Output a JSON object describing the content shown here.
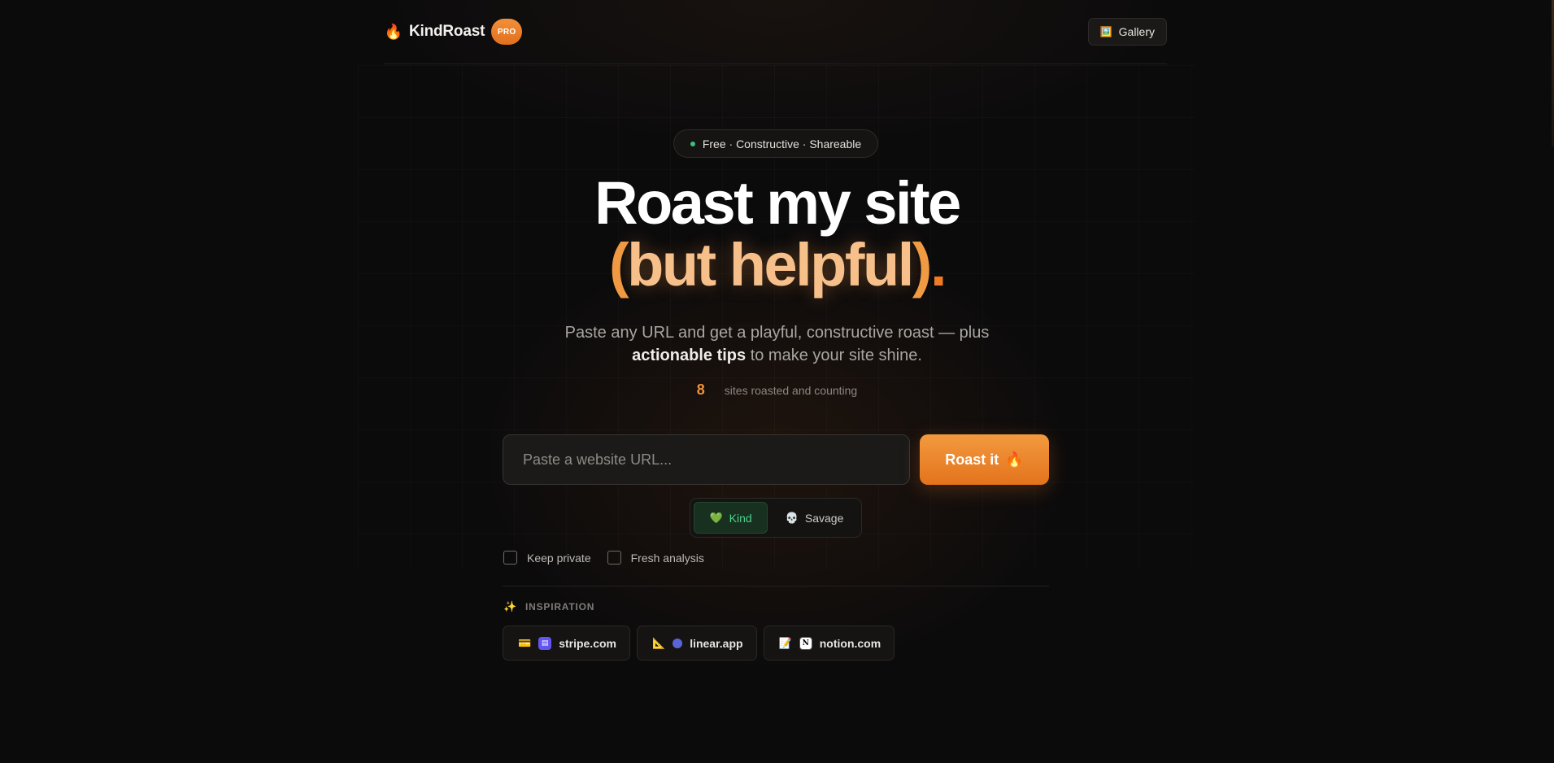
{
  "header": {
    "brand_icon": "fire-icon",
    "brand_name": "KindRoast",
    "pro_badge": "PRO",
    "gallery_icon": "picture-icon",
    "gallery_label": "Gallery"
  },
  "hero": {
    "pill_text": "Free · Constructive · Shareable",
    "title_line1": "Roast my site",
    "title_paren_open": "(",
    "title_helpful": "but helpful",
    "title_paren_close": ")",
    "title_dot": ".",
    "subtitle_part1": "Paste any URL and get a playful, constructive roast — plus",
    "subtitle_strong": "actionable tips",
    "subtitle_part2": "to make your site shine.",
    "count": "8",
    "count_label": "sites roasted and counting"
  },
  "form": {
    "url_placeholder": "Paste a website URL...",
    "url_value": "",
    "roast_label": "Roast it",
    "roast_icon": "fire-icon",
    "modes": [
      {
        "label": "Kind",
        "icon": "green-heart-icon",
        "selected": true
      },
      {
        "label": "Savage",
        "icon": "skull-icon",
        "selected": false
      }
    ],
    "keep_private_label": "Keep private",
    "keep_private_checked": false,
    "fresh_analysis_label": "Fresh analysis",
    "fresh_analysis_checked": false
  },
  "inspiration": {
    "icon": "sparkles-icon",
    "label": "INSPIRATION",
    "chips": [
      {
        "emoji": "credit-card-icon",
        "favicon": "stripe-favicon",
        "label": "stripe.com"
      },
      {
        "emoji": "triangular-ruler-icon",
        "favicon": "linear-favicon",
        "label": "linear.app"
      },
      {
        "emoji": "memo-icon",
        "favicon": "notion-favicon",
        "label": "notion.com"
      }
    ]
  },
  "colors": {
    "accent": "#f0913a",
    "accent_dark": "#e3731d",
    "kind_green": "#4fd08c",
    "background": "#0c0b0c"
  }
}
